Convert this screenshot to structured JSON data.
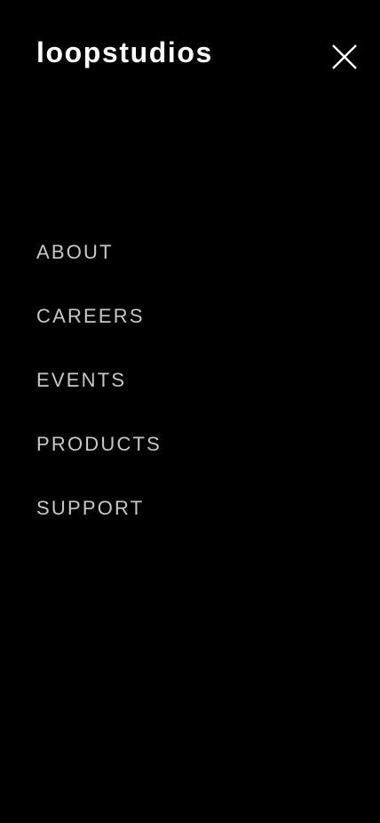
{
  "header": {
    "logo_text": "loopstudios",
    "close_icon": "close-icon"
  },
  "nav": {
    "items": [
      {
        "label": "ABOUT"
      },
      {
        "label": "CAREERS"
      },
      {
        "label": "EVENTS"
      },
      {
        "label": "PRODUCTS"
      },
      {
        "label": "SUPPORT"
      }
    ]
  },
  "colors": {
    "background": "#000000",
    "logo": "#ffffff",
    "nav_text": "#c8c8c8"
  }
}
